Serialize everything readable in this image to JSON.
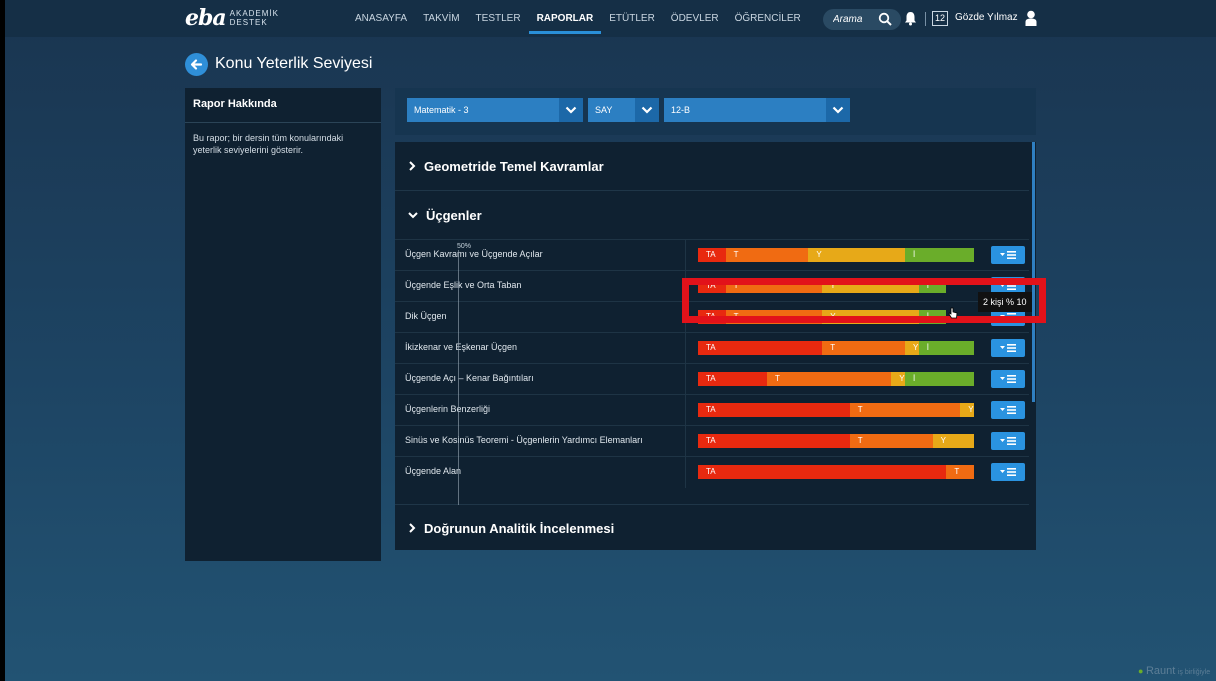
{
  "topbar": {
    "logo_text": "eba",
    "logo_sub1": "AKADEMİK",
    "logo_sub2": "DESTEK",
    "nav": [
      "ANASAYFA",
      "TAKVİM",
      "TESTLER",
      "RAPORLAR",
      "ETÜTLER",
      "ÖDEVLER",
      "ÖĞRENCİLER"
    ],
    "active_nav": "RAPORLAR",
    "search_placeholder": "Arama",
    "calendar_day": "12",
    "user_name": "Gözde Yılmaz"
  },
  "page": {
    "title": "Konu Yeterlik Seviyesi"
  },
  "about": {
    "heading": "Rapor Hakkında",
    "text": "Bu rapor; bir dersin tüm konularındaki yeterlik seviyelerini gösterir."
  },
  "filters": {
    "subject": "Matematik - 3",
    "type": "SAY",
    "class": "12-B"
  },
  "sections": {
    "s1": "Geometride Temel Kavramlar",
    "s2": "Üçgenler",
    "s3": "Doğrunun Analitik İncelenmesi"
  },
  "axis_label": "50%",
  "levels": {
    "TA": "#e8290f",
    "T": "#f06b12",
    "Y": "#e7a918",
    "I": "#6aad2a"
  },
  "topics": [
    {
      "name": "Üçgen Kavramı ve Üçgende Açılar",
      "segments": [
        {
          "label": "TA",
          "pct": 10
        },
        {
          "label": "T",
          "pct": 30
        },
        {
          "label": "Y",
          "pct": 35
        },
        {
          "label": "İ",
          "pct": 25
        }
      ]
    },
    {
      "name": "Üçgende Eşlik ve Orta Taban",
      "segments": [
        {
          "label": "TA",
          "pct": 10
        },
        {
          "label": "T",
          "pct": 35
        },
        {
          "label": "Y",
          "pct": 35
        },
        {
          "label": "İ",
          "pct": 10
        }
      ]
    },
    {
      "name": "Dik Üçgen",
      "segments": [
        {
          "label": "TA",
          "pct": 10
        },
        {
          "label": "T",
          "pct": 35
        },
        {
          "label": "Y",
          "pct": 35
        },
        {
          "label": "İ",
          "pct": 10
        }
      ]
    },
    {
      "name": "İkizkenar ve Eşkenar Üçgen",
      "segments": [
        {
          "label": "TA",
          "pct": 45
        },
        {
          "label": "T",
          "pct": 30
        },
        {
          "label": "Y",
          "pct": 5
        },
        {
          "label": "İ",
          "pct": 20
        }
      ]
    },
    {
      "name": "Üçgende Açı – Kenar Bağıntıları",
      "segments": [
        {
          "label": "TA",
          "pct": 25
        },
        {
          "label": "T",
          "pct": 45
        },
        {
          "label": "Y",
          "pct": 5
        },
        {
          "label": "İ",
          "pct": 25
        }
      ]
    },
    {
      "name": "Üçgenlerin Benzerliği",
      "segments": [
        {
          "label": "TA",
          "pct": 55
        },
        {
          "label": "T",
          "pct": 40
        },
        {
          "label": "Y",
          "pct": 5
        }
      ]
    },
    {
      "name": "Sinüs ve Kosinüs Teoremi - Üçgenlerin Yardımcı Elemanları",
      "segments": [
        {
          "label": "TA",
          "pct": 55
        },
        {
          "label": "T",
          "pct": 30
        },
        {
          "label": "Y",
          "pct": 15
        }
      ]
    },
    {
      "name": "Üçgende Alan",
      "segments": [
        {
          "label": "TA",
          "pct": 90
        },
        {
          "label": "T",
          "pct": 10
        }
      ]
    }
  ],
  "tooltip": "2 kişi % 10",
  "footer_brand": "Raunt",
  "footer_suffix": "iş birliğiyle"
}
